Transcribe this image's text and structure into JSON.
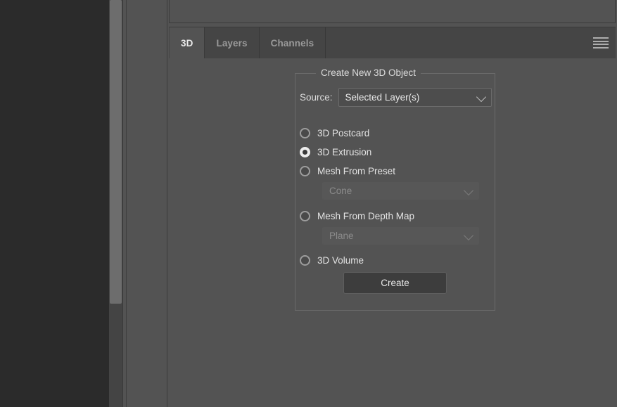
{
  "window": {
    "background_color": "#535353",
    "canvas_color": "#2b2b2b"
  },
  "scrollbar": {
    "name": "vertical-scrollbar",
    "thumb_color": "#6d6d6d",
    "track_color": "#444444"
  },
  "tabs": {
    "items": [
      {
        "label": "3D",
        "active": true
      },
      {
        "label": "Layers",
        "active": false
      },
      {
        "label": "Channels",
        "active": false
      }
    ],
    "menu_icon": "hamburger-menu-icon"
  },
  "panel": {
    "group": {
      "title": "Create New 3D Object",
      "source": {
        "label": "Source:",
        "value": "Selected Layer(s)",
        "chevron_icon": "chevron-down-icon",
        "enabled": true
      },
      "options": [
        {
          "label": "3D Postcard",
          "selected": false
        },
        {
          "label": "3D Extrusion",
          "selected": true
        },
        {
          "label": "Mesh From Preset",
          "selected": false
        },
        {
          "label": "Mesh From Depth Map",
          "selected": false
        },
        {
          "label": "3D Volume",
          "selected": false
        }
      ],
      "preset_select": {
        "value": "Cone",
        "enabled": false,
        "chevron_icon": "chevron-down-icon"
      },
      "depth_map_select": {
        "value": "Plane",
        "enabled": false,
        "chevron_icon": "chevron-down-icon"
      },
      "create_button": {
        "label": "Create"
      }
    }
  }
}
